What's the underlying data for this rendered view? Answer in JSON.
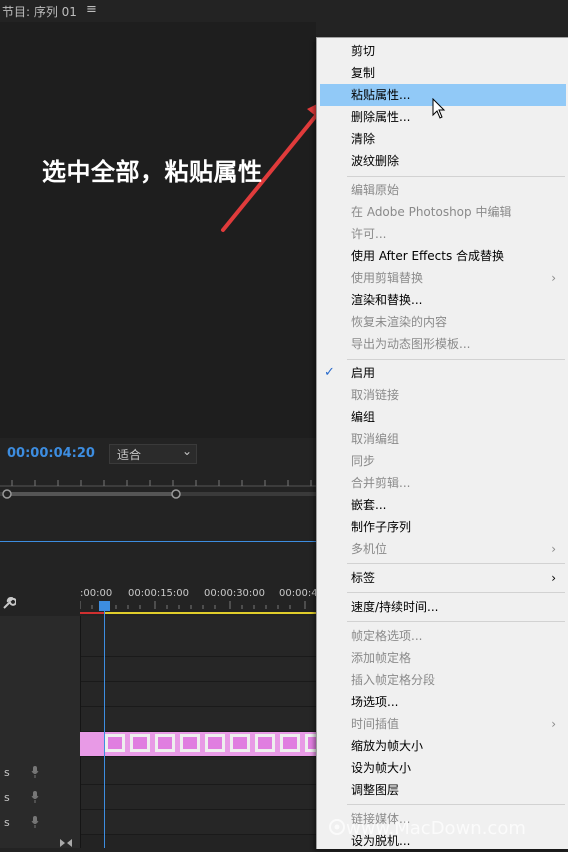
{
  "header": {
    "title": "节目: 序列 01",
    "menu_icon": "≡"
  },
  "annotation": {
    "text": "选中全部，粘贴属性"
  },
  "monitor": {
    "timecode": "00:00:04:20",
    "fit_select": "适合"
  },
  "timeline": {
    "times": [
      ":00:00",
      "00:00:15:00",
      "00:00:30:00",
      "00:00:4"
    ],
    "track_labels": [
      "s",
      "s",
      "s"
    ]
  },
  "menu": {
    "items": [
      {
        "label": "剪切",
        "state": "enabled"
      },
      {
        "label": "复制",
        "state": "enabled"
      },
      {
        "label": "粘贴属性...",
        "state": "highlighted"
      },
      {
        "label": "删除属性...",
        "state": "enabled"
      },
      {
        "label": "清除",
        "state": "enabled"
      },
      {
        "label": "波纹删除",
        "state": "enabled"
      },
      {
        "label": "编辑原始",
        "state": "disabled"
      },
      {
        "label": "在 Adobe Photoshop 中编辑",
        "state": "disabled"
      },
      {
        "label": "许可...",
        "state": "disabled"
      },
      {
        "label": "使用 After Effects 合成替换",
        "state": "enabled"
      },
      {
        "label": "使用剪辑替换",
        "state": "disabled",
        "submenu": true
      },
      {
        "label": "渲染和替换...",
        "state": "enabled"
      },
      {
        "label": "恢复未渲染的内容",
        "state": "disabled"
      },
      {
        "label": "导出为动态图形模板...",
        "state": "disabled"
      },
      {
        "label": "启用",
        "state": "enabled",
        "checked": true
      },
      {
        "label": "取消链接",
        "state": "disabled"
      },
      {
        "label": "编组",
        "state": "enabled"
      },
      {
        "label": "取消编组",
        "state": "disabled"
      },
      {
        "label": "同步",
        "state": "disabled"
      },
      {
        "label": "合并剪辑...",
        "state": "disabled"
      },
      {
        "label": "嵌套...",
        "state": "enabled"
      },
      {
        "label": "制作子序列",
        "state": "enabled"
      },
      {
        "label": "多机位",
        "state": "disabled",
        "submenu": true
      },
      {
        "label": "标签",
        "state": "enabled",
        "submenu": true
      },
      {
        "label": "速度/持续时间...",
        "state": "enabled"
      },
      {
        "label": "帧定格选项...",
        "state": "disabled"
      },
      {
        "label": "添加帧定格",
        "state": "disabled"
      },
      {
        "label": "插入帧定格分段",
        "state": "disabled"
      },
      {
        "label": "场选项...",
        "state": "enabled"
      },
      {
        "label": "时间插值",
        "state": "disabled",
        "submenu": true
      },
      {
        "label": "缩放为帧大小",
        "state": "enabled"
      },
      {
        "label": "设为帧大小",
        "state": "enabled"
      },
      {
        "label": "调整图层",
        "state": "enabled"
      },
      {
        "label": "链接媒体...",
        "state": "disabled"
      },
      {
        "label": "设为脱机...",
        "state": "enabled"
      }
    ],
    "check_mark": "✓",
    "submenu_arrow": "›"
  },
  "watermark": {
    "text": "www.MacDown.com"
  },
  "colors": {
    "accent_blue": "#3d8de0",
    "highlight": "#91c9f7",
    "clip_pink": "#e07ee0",
    "arrow_red": "#e03b3b"
  }
}
